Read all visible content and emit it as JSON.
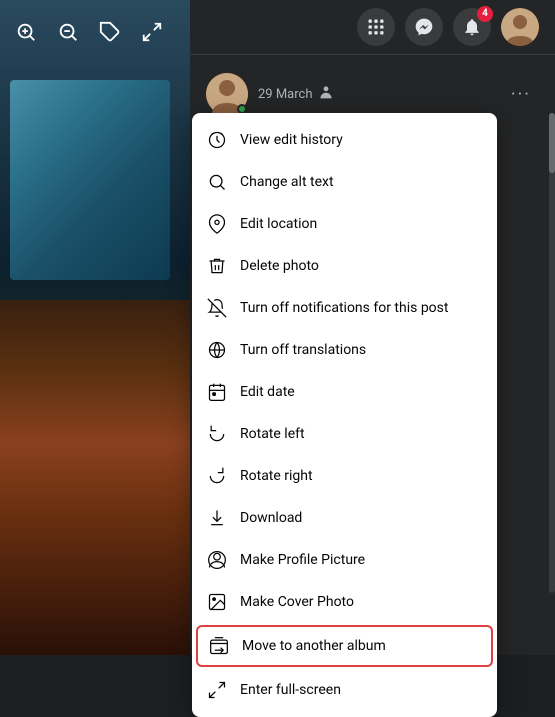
{
  "colors": {
    "accent_red": "#e04040",
    "bg_dark": "#242526",
    "text_primary": "#050505",
    "text_secondary": "#b0b3b8"
  },
  "header": {
    "icons": [
      "grid-icon",
      "messenger-icon",
      "notifications-icon",
      "avatar-icon"
    ],
    "notification_badge": "4"
  },
  "post": {
    "date": "29 March",
    "more_label": "···"
  },
  "menu": {
    "items": [
      {
        "id": "view-edit-history",
        "label": "View edit history",
        "icon": "clock-icon"
      },
      {
        "id": "change-alt-text",
        "label": "Change alt text",
        "icon": "search-icon"
      },
      {
        "id": "edit-location",
        "label": "Edit location",
        "icon": "location-icon"
      },
      {
        "id": "delete-photo",
        "label": "Delete photo",
        "icon": "trash-icon"
      },
      {
        "id": "turn-off-notifications",
        "label": "Turn off notifications for this post",
        "icon": "bell-off-icon"
      },
      {
        "id": "turn-off-translations",
        "label": "Turn off translations",
        "icon": "globe-icon"
      },
      {
        "id": "edit-date",
        "label": "Edit date",
        "icon": "calendar-icon"
      },
      {
        "id": "rotate-left",
        "label": "Rotate left",
        "icon": "rotate-left-icon"
      },
      {
        "id": "rotate-right",
        "label": "Rotate right",
        "icon": "rotate-right-icon"
      },
      {
        "id": "download",
        "label": "Download",
        "icon": "download-icon"
      },
      {
        "id": "make-profile-picture",
        "label": "Make Profile Picture",
        "icon": "profile-icon"
      },
      {
        "id": "make-cover-photo",
        "label": "Make Cover Photo",
        "icon": "image-icon"
      },
      {
        "id": "move-to-album",
        "label": "Move to another album",
        "icon": "album-icon",
        "highlighted": true
      },
      {
        "id": "enter-full-screen",
        "label": "Enter full-screen",
        "icon": "fullscreen-icon"
      }
    ]
  },
  "top_icons": {
    "zoom_in": "⊕",
    "zoom_out": "⊖",
    "tag": "⌂",
    "expand": "⛶"
  }
}
